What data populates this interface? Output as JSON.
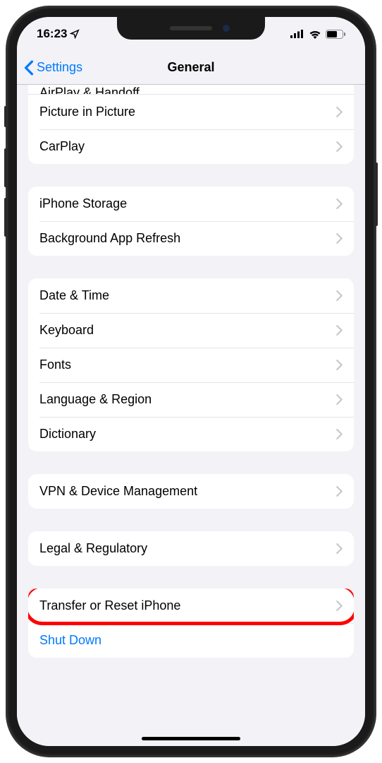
{
  "statusbar": {
    "time": "16:23",
    "location_icon": "location-arrow",
    "signal_bars": 4,
    "wifi": true,
    "battery_icon": "battery"
  },
  "nav": {
    "back_label": "Settings",
    "title": "General"
  },
  "groups": [
    {
      "id": "group-top",
      "truncated_label": "AirPlay & Handoff",
      "items": [
        {
          "id": "picture-in-picture",
          "label": "Picture in Picture",
          "disclosure": true
        },
        {
          "id": "carplay",
          "label": "CarPlay",
          "disclosure": true
        }
      ]
    },
    {
      "id": "group-storage",
      "items": [
        {
          "id": "iphone-storage",
          "label": "iPhone Storage",
          "disclosure": true
        },
        {
          "id": "background-app-refresh",
          "label": "Background App Refresh",
          "disclosure": true
        }
      ]
    },
    {
      "id": "group-locale",
      "items": [
        {
          "id": "date-time",
          "label": "Date & Time",
          "disclosure": true
        },
        {
          "id": "keyboard",
          "label": "Keyboard",
          "disclosure": true
        },
        {
          "id": "fonts",
          "label": "Fonts",
          "disclosure": true
        },
        {
          "id": "language-region",
          "label": "Language & Region",
          "disclosure": true
        },
        {
          "id": "dictionary",
          "label": "Dictionary",
          "disclosure": true
        }
      ]
    },
    {
      "id": "group-vpn",
      "items": [
        {
          "id": "vpn-device-management",
          "label": "VPN & Device Management",
          "disclosure": true
        }
      ]
    },
    {
      "id": "group-legal",
      "items": [
        {
          "id": "legal-regulatory",
          "label": "Legal & Regulatory",
          "disclosure": true
        }
      ]
    },
    {
      "id": "group-reset",
      "items": [
        {
          "id": "transfer-reset",
          "label": "Transfer or Reset iPhone",
          "disclosure": true,
          "highlighted": true
        },
        {
          "id": "shut-down",
          "label": "Shut Down",
          "disclosure": false,
          "action": true
        }
      ]
    }
  ],
  "annotation": {
    "highlight_target": "transfer-reset",
    "highlight_color": "#ff0000"
  }
}
